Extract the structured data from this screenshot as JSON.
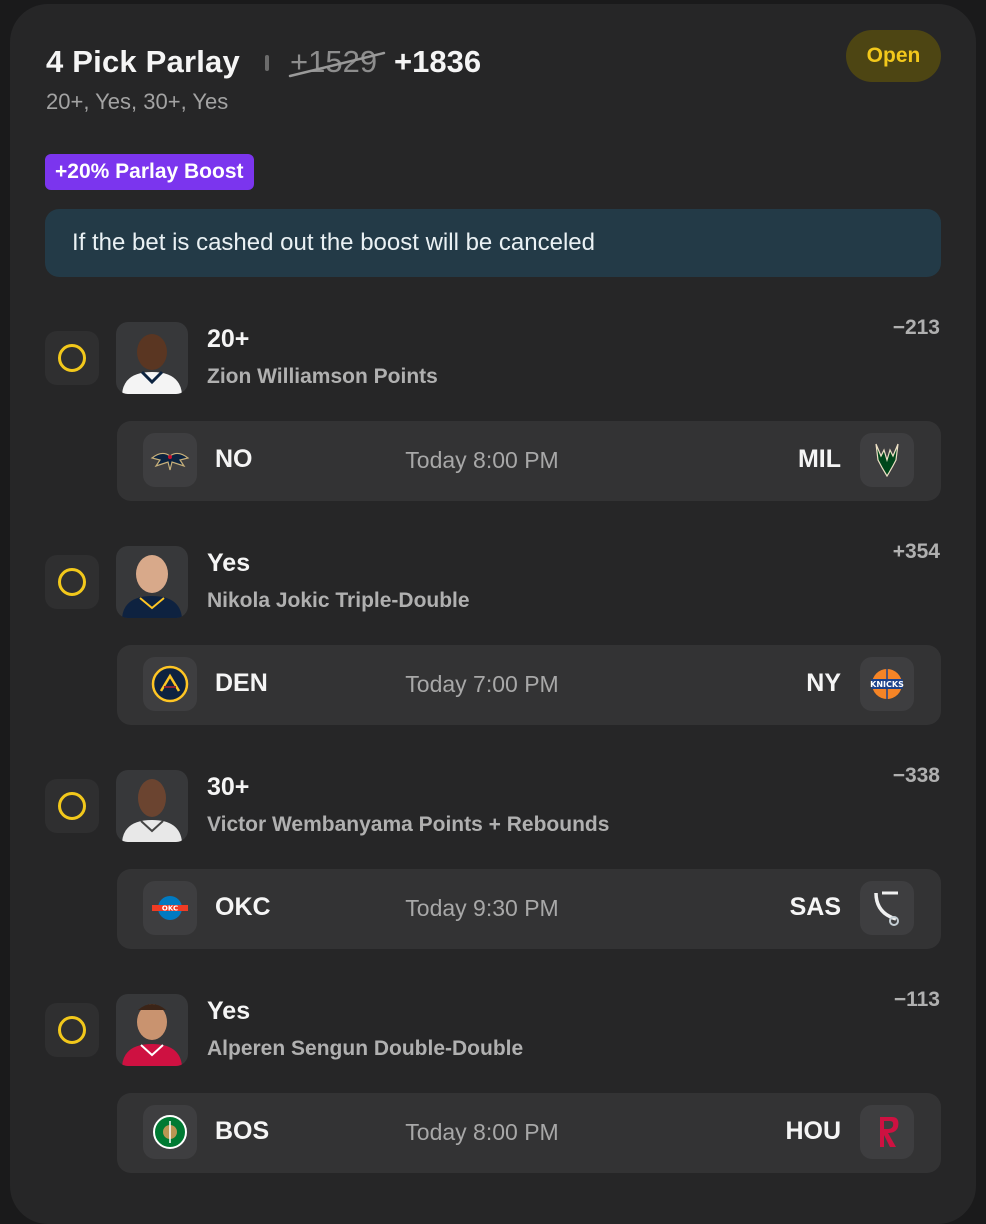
{
  "header": {
    "title": "4 Pick Parlay",
    "old_odds": "+1529",
    "new_odds": "+1836",
    "subtitle": "20+, Yes, 30+, Yes",
    "status": "Open",
    "boost": "+20% Parlay Boost",
    "notice": "If the bet is cashed out the boost will be canceled"
  },
  "legs": [
    {
      "selection": "20+",
      "market": "Zion Williamson Points",
      "odds": "−213",
      "home_team": "NO",
      "away_team": "MIL",
      "time": "Today 8:00 PM",
      "home_logo": "pelicans-logo-icon",
      "away_logo": "bucks-logo-icon",
      "jersey_color": "#f4f4f4"
    },
    {
      "selection": "Yes",
      "market": "Nikola Jokic Triple-Double",
      "odds": "+354",
      "home_team": "DEN",
      "away_team": "NY",
      "time": "Today 7:00 PM",
      "home_logo": "nuggets-logo-icon",
      "away_logo": "knicks-logo-icon",
      "jersey_color": "#0e2240"
    },
    {
      "selection": "30+",
      "market": "Victor Wembanyama Points + Rebounds",
      "odds": "−338",
      "home_team": "OKC",
      "away_team": "SAS",
      "time": "Today 9:30 PM",
      "home_logo": "thunder-logo-icon",
      "away_logo": "spurs-logo-icon",
      "jersey_color": "#e8e8e8"
    },
    {
      "selection": "Yes",
      "market": "Alperen Sengun Double-Double",
      "odds": "−113",
      "home_team": "BOS",
      "away_team": "HOU",
      "time": "Today 8:00 PM",
      "home_logo": "celtics-logo-icon",
      "away_logo": "rockets-logo-icon",
      "jersey_color": "#ce1141"
    }
  ]
}
